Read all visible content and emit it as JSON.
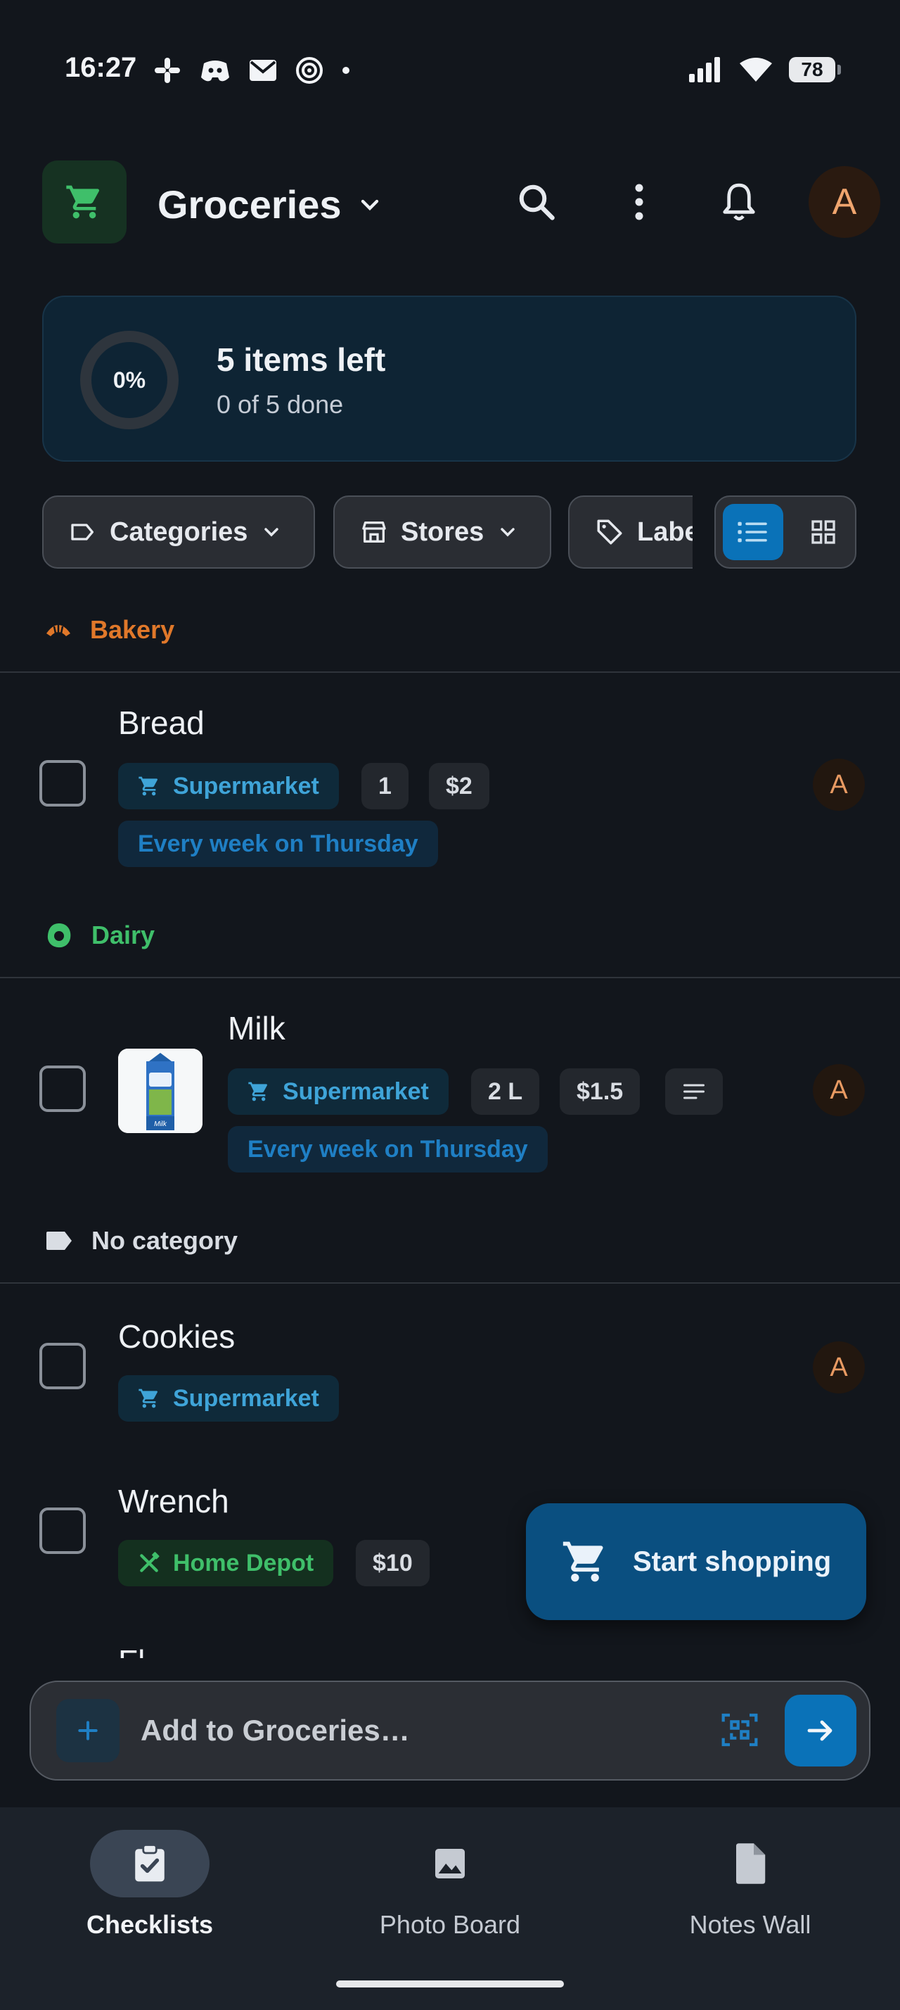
{
  "status_bar": {
    "time": "16:27",
    "battery": "78"
  },
  "app_bar": {
    "avatar_initial": "A",
    "list_title": "Groceries"
  },
  "progress": {
    "percent_label": "0%",
    "percent_value": 0,
    "title": "5 items left",
    "subtitle": "0 of 5 done"
  },
  "filters": {
    "categories": "Categories",
    "stores": "Stores",
    "labels": "Labels",
    "active_view": "list"
  },
  "sections": [
    {
      "name": "Bakery",
      "color": "#e0782a",
      "items": [
        {
          "name": "Bread",
          "store": "Supermarket",
          "quantity": "1",
          "price": "$2",
          "repeat": "Every week on Thursday",
          "assignee": "A"
        }
      ]
    },
    {
      "name": "Dairy",
      "color": "#3fbf6a",
      "items": [
        {
          "name": "Milk",
          "store": "Supermarket",
          "quantity": "2 L",
          "price": "$1.5",
          "has_notes": true,
          "repeat": "Every week on Thursday",
          "assignee": "A",
          "thumbnail_label": "Milk"
        }
      ]
    },
    {
      "name": "No category",
      "color": "#d9dde3",
      "items": [
        {
          "name": "Cookies",
          "store": "Supermarket",
          "assignee": "A"
        },
        {
          "name": "Wrench",
          "store": "Home Depot",
          "price": "$10"
        },
        {
          "name": "Fl..."
        }
      ]
    }
  ],
  "fab": {
    "label": "Start shopping"
  },
  "add_bar": {
    "placeholder": "Add to Groceries…"
  },
  "bottom_nav": [
    {
      "label": "Checklists",
      "icon": "checklist-icon",
      "active": true
    },
    {
      "label": "Photo Board",
      "icon": "image-icon",
      "active": false
    },
    {
      "label": "Notes Wall",
      "icon": "document-icon",
      "active": false
    }
  ],
  "colors": {
    "accent": "#0a72b8",
    "store_blue": "#3fa4d8",
    "store_green": "#3fbf6a",
    "bakery": "#e0782a",
    "avatar": "#e89a62"
  }
}
